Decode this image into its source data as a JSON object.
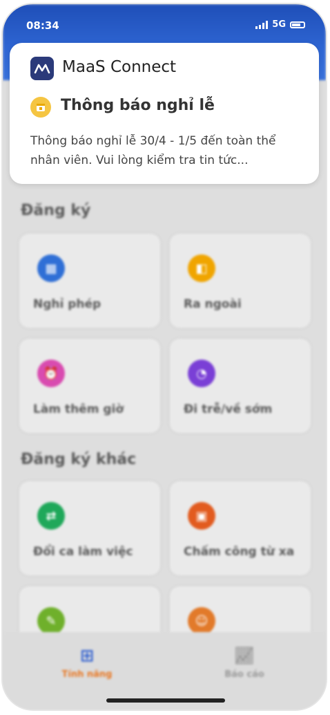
{
  "status_bar": {
    "time": "08:34",
    "network": "5G"
  },
  "notification": {
    "app_name": "MaaS Connect",
    "title": "Thông báo nghỉ lễ",
    "body": "Thông báo nghỉ lễ 30/4 - 1/5 đến toàn thể nhân viên. Vui lòng kiểm tra tin tức..."
  },
  "sections": [
    {
      "title": "Đăng ký",
      "items": [
        {
          "label": "Nghỉ phép",
          "icon": "calendar-icon",
          "color": "#2f6fd6"
        },
        {
          "label": "Ra ngoài",
          "icon": "exit-door-icon",
          "color": "#f0a500"
        },
        {
          "label": "Làm thêm giờ",
          "icon": "alarm-clock-icon",
          "color": "#d94bb0"
        },
        {
          "label": "Đi trễ/về sớm",
          "icon": "stopwatch-icon",
          "color": "#7a3fd6"
        }
      ]
    },
    {
      "title": "Đăng ký khác",
      "items": [
        {
          "label": "Đổi ca làm việc",
          "icon": "swap-arrows-icon",
          "color": "#1fa85a"
        },
        {
          "label": "Chấm công từ xa",
          "icon": "remote-checkin-icon",
          "color": "#e25b1f"
        },
        {
          "label": "",
          "icon": "edit-note-icon",
          "color": "#6fb02b"
        },
        {
          "label": "",
          "icon": "person-icon",
          "color": "#e27a2a"
        }
      ]
    }
  ],
  "bottom_nav": {
    "features": {
      "label": "Tính năng",
      "color": "#e87722"
    },
    "reports": {
      "label": "Báo cáo",
      "color": "#9a9a9a"
    }
  }
}
